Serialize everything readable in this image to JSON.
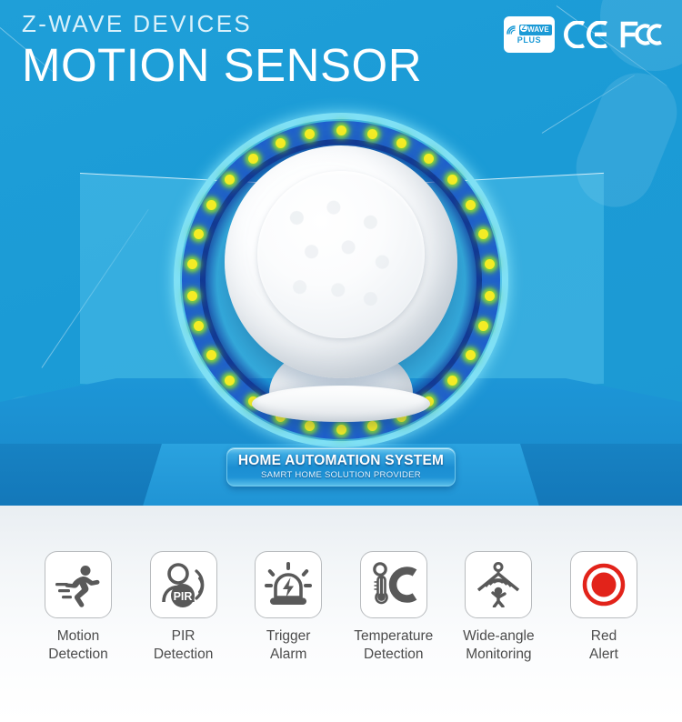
{
  "header": {
    "kicker": "Z-WAVE DEVICES",
    "headline": "MOTION SENSOR"
  },
  "certifications": [
    {
      "name": "zwave-plus-logo",
      "wordmark": "WAVE",
      "badge_letter": "Z",
      "plus": "PLUS"
    },
    {
      "name": "ce-mark",
      "label": "CE"
    },
    {
      "name": "fcc-mark",
      "label": "FC"
    }
  ],
  "product": {
    "name": "spherical-pir-motion-sensor",
    "led_count": 30
  },
  "plaque": {
    "title": "HOME AUTOMATION SYSTEM",
    "subtitle": "SAMRT HOME SOLUTION PROVIDER"
  },
  "features": [
    {
      "icon": "running-person-icon",
      "label": "Motion\nDetection"
    },
    {
      "icon": "pir-person-waves-icon",
      "label": "PIR\nDetection"
    },
    {
      "icon": "alarm-siren-icon",
      "label": "Trigger\nAlarm"
    },
    {
      "icon": "thermometer-celsius-icon",
      "label": "Temperature\nDetection"
    },
    {
      "icon": "wide-angle-coverage-icon",
      "label": "Wide-angle\nMonitoring"
    },
    {
      "icon": "red-alert-dot-icon",
      "label": "Red\nAlert"
    }
  ],
  "colors": {
    "brand_blue": "#1b9ad6",
    "deep_blue": "#1f5fcf",
    "cyan_ring": "#7fe0f5",
    "led_yellow": "#f4ec25",
    "alert_red": "#e2231a",
    "icon_gray": "#595959",
    "label_gray": "#4c4c4c",
    "panel_white": "#ffffff"
  }
}
